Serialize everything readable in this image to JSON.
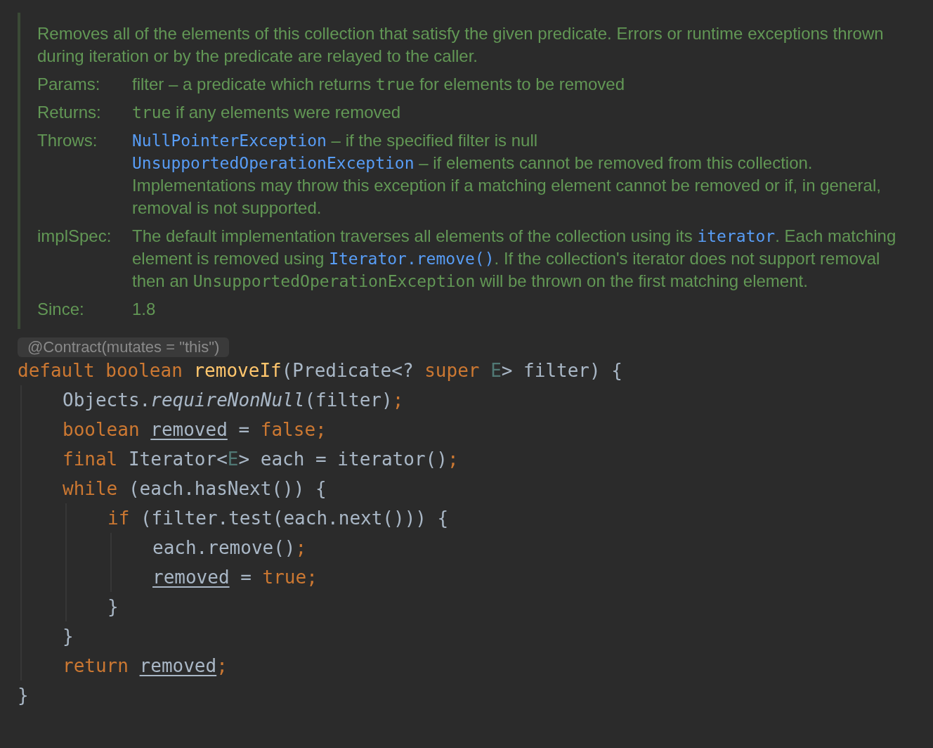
{
  "doc": {
    "description": "Removes all of the elements of this collection that satisfy the given predicate. Errors or runtime exceptions thrown during iteration or by the predicate are relayed to the caller.",
    "sections": [
      {
        "label": "Params:",
        "paragraphs": [
          [
            {
              "kind": "text",
              "text": "filter – a predicate which returns "
            },
            {
              "kind": "code",
              "text": "true"
            },
            {
              "kind": "text",
              "text": " for elements to be removed"
            }
          ]
        ]
      },
      {
        "label": "Returns:",
        "paragraphs": [
          [
            {
              "kind": "code",
              "text": "true"
            },
            {
              "kind": "text",
              "text": " if any elements were removed"
            }
          ]
        ]
      },
      {
        "label": "Throws:",
        "paragraphs": [
          [
            {
              "kind": "link",
              "text": "NullPointerException"
            },
            {
              "kind": "text",
              "text": " – if the specified filter is null"
            }
          ],
          [
            {
              "kind": "link",
              "text": "UnsupportedOperationException"
            },
            {
              "kind": "text",
              "text": " – if elements cannot be removed from this collection. Implementations may throw this exception if a matching element cannot be removed or if, in general, removal is not supported."
            }
          ]
        ]
      },
      {
        "label": "implSpec:",
        "paragraphs": [
          [
            {
              "kind": "text",
              "text": "The default implementation traverses all elements of the collection using its "
            },
            {
              "kind": "link",
              "text": "iterator"
            },
            {
              "kind": "text",
              "text": ". Each matching element is removed using "
            },
            {
              "kind": "link",
              "text": "Iterator.remove()"
            },
            {
              "kind": "text",
              "text": ". If the collection's iterator does not support removal then an "
            },
            {
              "kind": "code",
              "text": "UnsupportedOperationException"
            },
            {
              "kind": "text",
              "text": " will be thrown on the first matching element."
            }
          ]
        ]
      },
      {
        "label": "Since:",
        "paragraphs": [
          [
            {
              "kind": "text",
              "text": "1.8"
            }
          ]
        ]
      }
    ]
  },
  "code": {
    "annotation": "@Contract(mutates = \"this\")",
    "lines": [
      {
        "tokens": [
          {
            "kind": "keyword",
            "text": "default "
          },
          {
            "kind": "keyword",
            "text": "boolean "
          },
          {
            "kind": "method",
            "text": "removeIf"
          },
          {
            "kind": "plain",
            "text": "(Predicate<? "
          },
          {
            "kind": "keyword",
            "text": "super "
          },
          {
            "kind": "type_param",
            "text": "E"
          },
          {
            "kind": "plain",
            "text": "> filter) {"
          }
        ],
        "children": [
          {
            "tokens": [
              {
                "kind": "plain",
                "text": "Objects."
              },
              {
                "kind": "static",
                "text": "requireNonNull"
              },
              {
                "kind": "plain",
                "text": "(filter)"
              },
              {
                "kind": "keyword",
                "text": ";"
              }
            ]
          },
          {
            "tokens": [
              {
                "kind": "keyword",
                "text": "boolean "
              },
              {
                "kind": "variable",
                "text": "removed"
              },
              {
                "kind": "plain",
                "text": " = "
              },
              {
                "kind": "keyword",
                "text": "false;"
              }
            ]
          },
          {
            "tokens": [
              {
                "kind": "keyword",
                "text": "final "
              },
              {
                "kind": "plain",
                "text": "Iterator<"
              },
              {
                "kind": "type_param",
                "text": "E"
              },
              {
                "kind": "plain",
                "text": "> each = iterator()"
              },
              {
                "kind": "keyword",
                "text": ";"
              }
            ]
          },
          {
            "tokens": [
              {
                "kind": "keyword",
                "text": "while "
              },
              {
                "kind": "plain",
                "text": "(each.hasNext()) {"
              }
            ],
            "children": [
              {
                "tokens": [
                  {
                    "kind": "keyword",
                    "text": "if "
                  },
                  {
                    "kind": "plain",
                    "text": "(filter.test(each.next())) {"
                  }
                ],
                "children": [
                  {
                    "tokens": [
                      {
                        "kind": "plain",
                        "text": "each.remove()"
                      },
                      {
                        "kind": "keyword",
                        "text": ";"
                      }
                    ]
                  },
                  {
                    "tokens": [
                      {
                        "kind": "variable",
                        "text": "removed"
                      },
                      {
                        "kind": "plain",
                        "text": " = "
                      },
                      {
                        "kind": "keyword",
                        "text": "true;"
                      }
                    ]
                  }
                ]
              },
              {
                "tokens": [
                  {
                    "kind": "plain",
                    "text": "}"
                  }
                ]
              }
            ]
          },
          {
            "tokens": [
              {
                "kind": "plain",
                "text": "}"
              }
            ]
          },
          {
            "tokens": [
              {
                "kind": "keyword",
                "text": "return "
              },
              {
                "kind": "variable",
                "text": "removed"
              },
              {
                "kind": "keyword",
                "text": ";"
              }
            ]
          }
        ]
      },
      {
        "tokens": [
          {
            "kind": "plain",
            "text": "}"
          }
        ]
      }
    ]
  }
}
